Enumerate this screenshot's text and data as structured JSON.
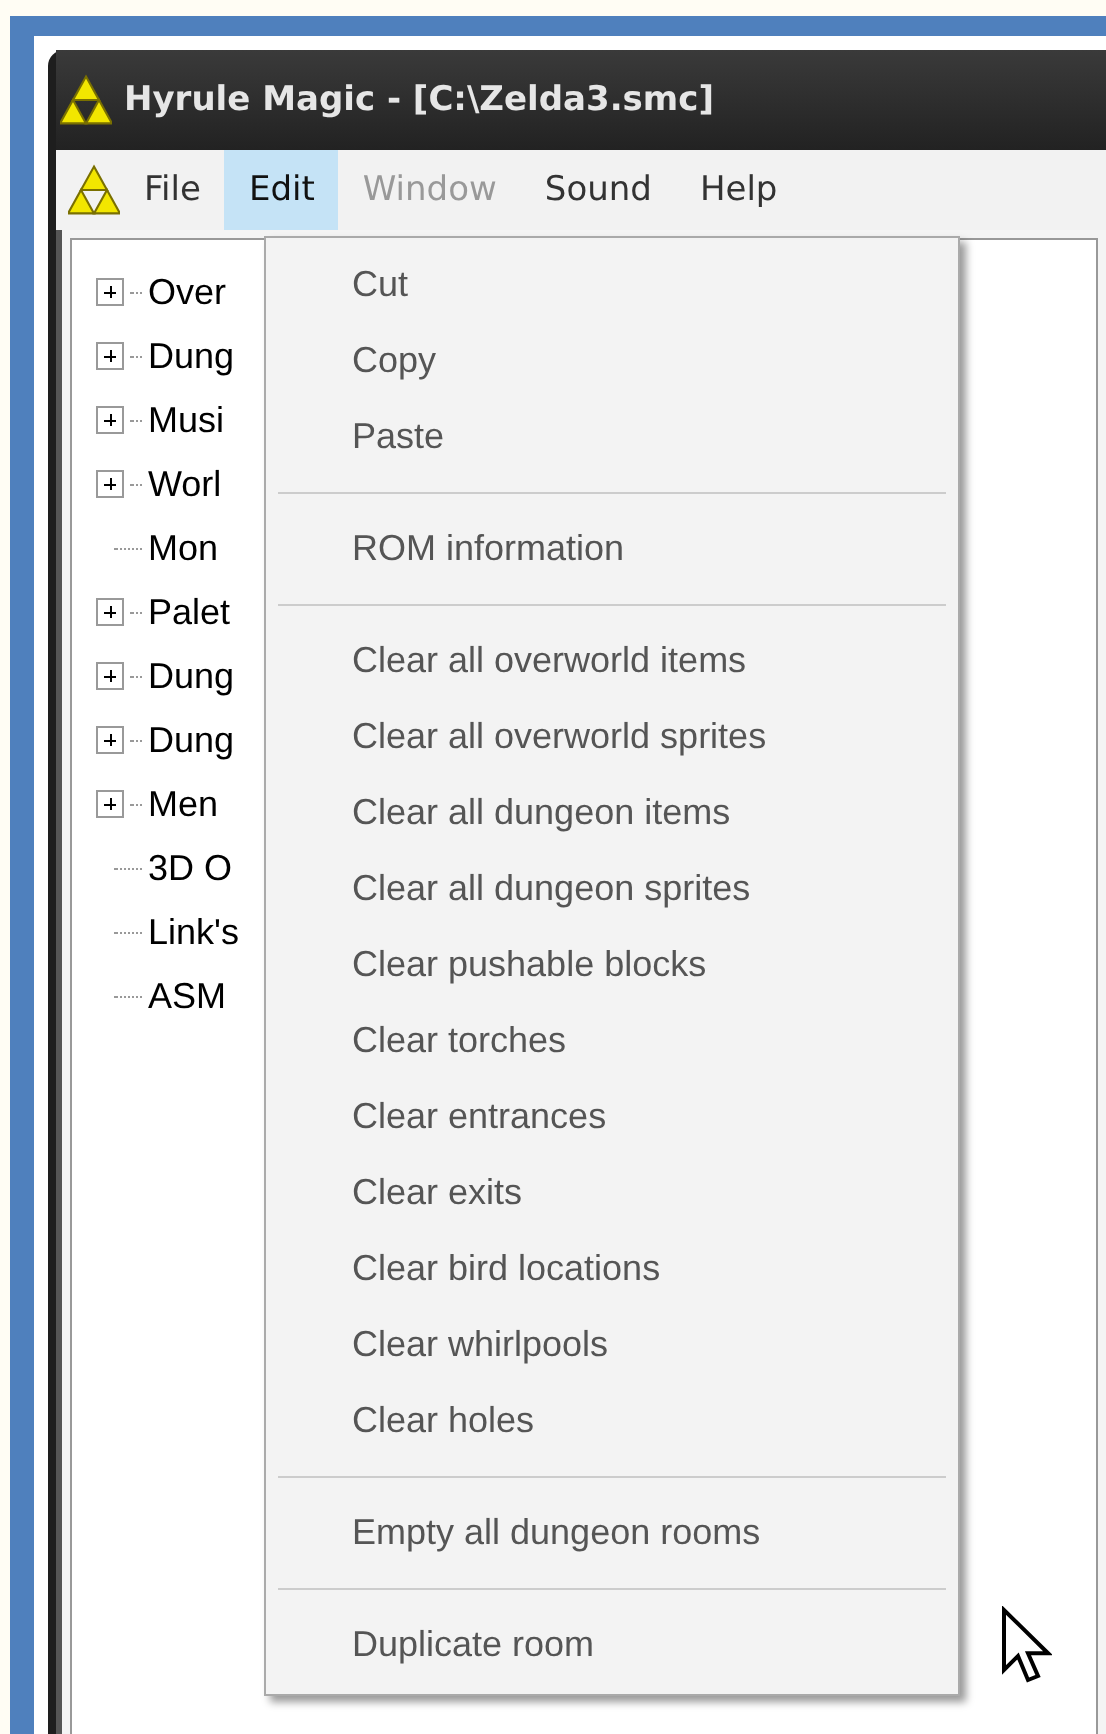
{
  "window": {
    "title": "Hyrule Magic - [C:\\Zelda3.smc]"
  },
  "menu_bar": [
    {
      "label": "File",
      "selected": false,
      "disabled": false
    },
    {
      "label": "Edit",
      "selected": true,
      "disabled": false
    },
    {
      "label": "Window",
      "selected": false,
      "disabled": true
    },
    {
      "label": "Sound",
      "selected": false,
      "disabled": false
    },
    {
      "label": "Help",
      "selected": false,
      "disabled": false
    }
  ],
  "tree": [
    {
      "label": "Over",
      "kind": "node",
      "expanded": false
    },
    {
      "label": "Dung",
      "kind": "node",
      "expanded": false
    },
    {
      "label": "Musi",
      "kind": "node",
      "expanded": false
    },
    {
      "label": "Worl",
      "kind": "node",
      "expanded": false
    },
    {
      "label": "Mon",
      "kind": "leaf"
    },
    {
      "label": "Palet",
      "kind": "node",
      "expanded": false
    },
    {
      "label": "Dung",
      "kind": "node",
      "expanded": false
    },
    {
      "label": "Dung",
      "kind": "node",
      "expanded": false
    },
    {
      "label": "Men",
      "kind": "node",
      "expanded": false
    },
    {
      "label": "3D O",
      "kind": "leaf"
    },
    {
      "label": "Link's",
      "kind": "leaf"
    },
    {
      "label": "ASM",
      "kind": "leaf"
    }
  ],
  "edit_menu": [
    {
      "kind": "item",
      "label": "Cut"
    },
    {
      "kind": "item",
      "label": "Copy"
    },
    {
      "kind": "item",
      "label": "Paste"
    },
    {
      "kind": "separator"
    },
    {
      "kind": "item",
      "label": "ROM information"
    },
    {
      "kind": "separator"
    },
    {
      "kind": "item",
      "label": "Clear all overworld items"
    },
    {
      "kind": "item",
      "label": "Clear all overworld sprites"
    },
    {
      "kind": "item",
      "label": "Clear all dungeon items"
    },
    {
      "kind": "item",
      "label": "Clear all dungeon sprites"
    },
    {
      "kind": "item",
      "label": "Clear pushable blocks"
    },
    {
      "kind": "item",
      "label": "Clear torches"
    },
    {
      "kind": "item",
      "label": "Clear entrances"
    },
    {
      "kind": "item",
      "label": "Clear exits"
    },
    {
      "kind": "item",
      "label": "Clear bird locations"
    },
    {
      "kind": "item",
      "label": "Clear whirlpools"
    },
    {
      "kind": "item",
      "label": "Clear holes"
    },
    {
      "kind": "separator"
    },
    {
      "kind": "item",
      "label": "Empty all dungeon rooms"
    },
    {
      "kind": "separator"
    },
    {
      "kind": "item",
      "label": "Duplicate room"
    }
  ]
}
